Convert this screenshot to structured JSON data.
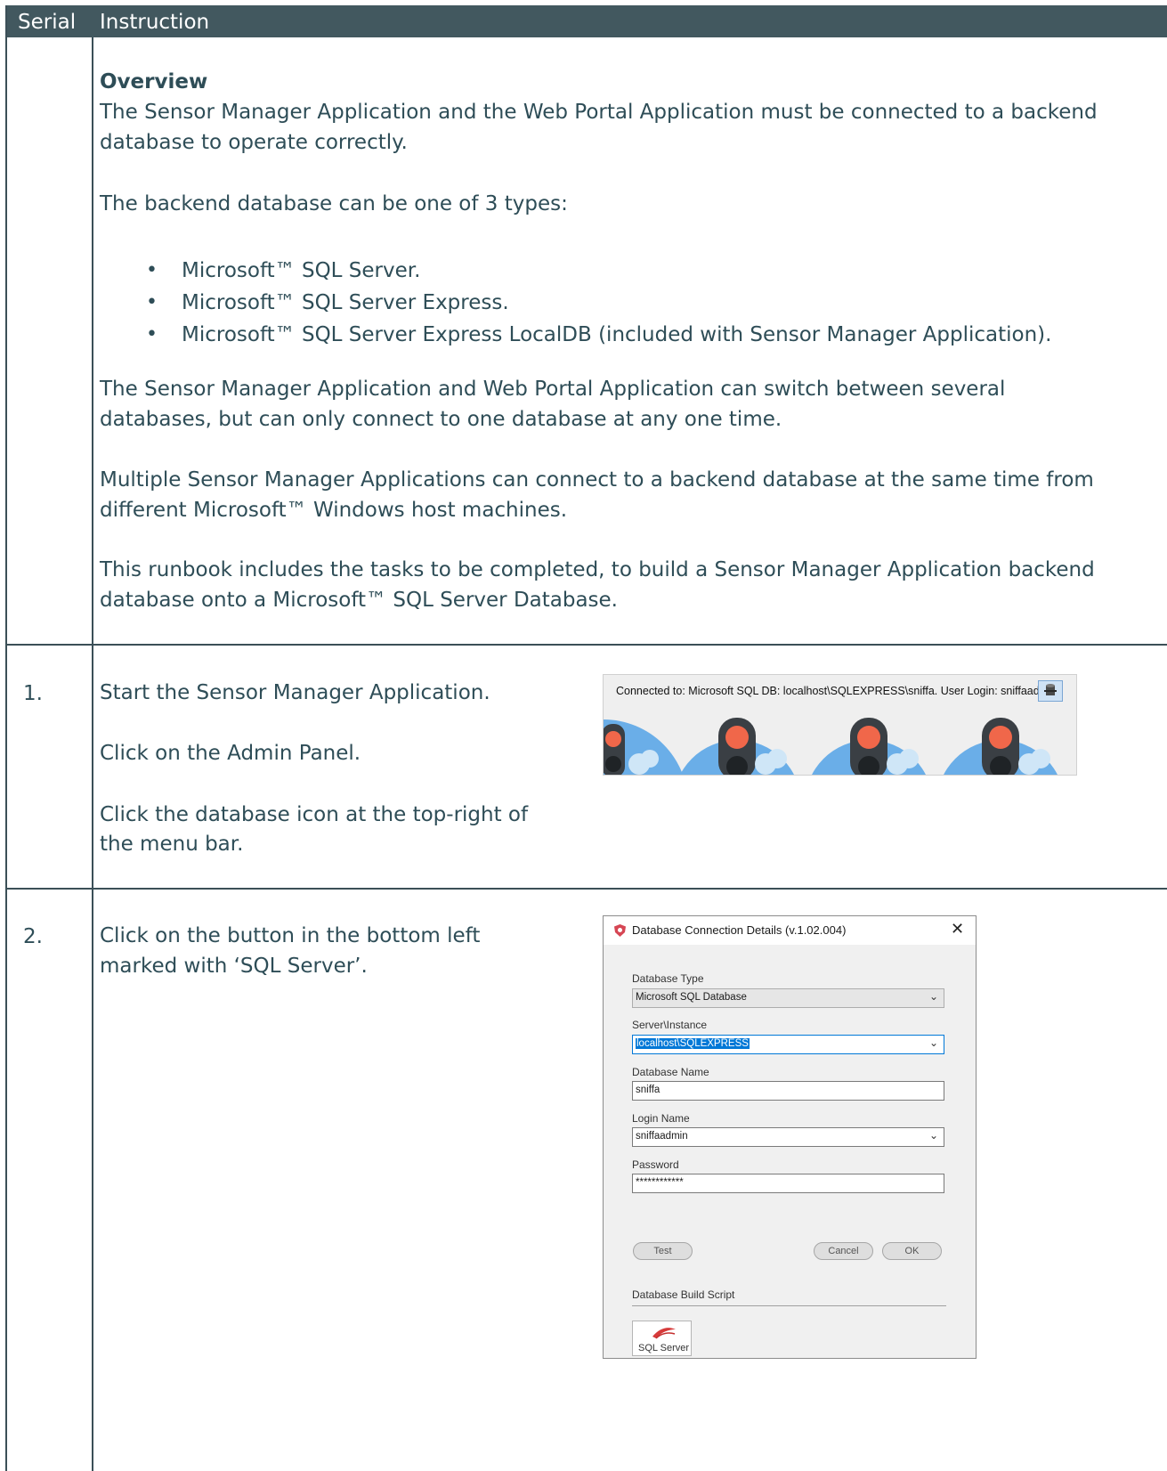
{
  "header": {
    "col1": "Serial",
    "col2": "Instruction"
  },
  "overview": {
    "heading": "Overview",
    "p1a": "The Sensor Manager Application and the Web Portal Application must be connected to a backend",
    "p1b": "database to operate correctly.",
    "p2": "The backend database can be one of 3 types:",
    "bullets": [
      "Microsoft™ SQL Server.",
      "Microsoft™ SQL Server Express.",
      "Microsoft™ SQL Server Express LocalDB (included with Sensor Manager Application)."
    ],
    "p3a": "The Sensor Manager Application and Web Portal Application can switch between several",
    "p3b": "databases, but can only connect to one database at any one time.",
    "p4a": "Multiple Sensor Manager Applications can connect to a backend database at the same time from",
    "p4b": "different Microsoft™ Windows host machines.",
    "p5a": "This runbook includes the tasks to be completed, to build a Sensor Manager Application backend",
    "p5b": "database onto a Microsoft™ SQL Server Database."
  },
  "step1": {
    "serial": "1.",
    "line1": "Start the Sensor Manager Application.",
    "line2": "Click on the Admin Panel.",
    "line3a": "Click the database icon at the top-right of",
    "line3b": "the menu bar.",
    "status_text": "Connected to: Microsoft SQL DB: localhost\\SQLEXPRESS\\sniffa. User Login: sniffaadmin.",
    "db_icon": "database-icon"
  },
  "step2": {
    "serial": "2.",
    "line1": "Click on the button in the bottom left",
    "line2": "marked with ‘SQL Server’."
  },
  "dialog": {
    "title": "Database Connection Details (v.1.02.004)",
    "close": "✕",
    "db_type_label": "Database Type",
    "db_type_value": "Microsoft SQL Database",
    "server_label": "Server\\Instance",
    "server_value": "localhost\\SQLEXPRESS",
    "dbname_label": "Database Name",
    "dbname_value": "sniffa",
    "login_label": "Login Name",
    "login_value": "sniffaadmin",
    "password_label": "Password",
    "password_value": "************",
    "test": "Test",
    "cancel": "Cancel",
    "ok": "OK",
    "build_script_label": "Database Build Script",
    "sql_server_button": "SQL Server"
  },
  "colors": {
    "header_bg": "#42585f",
    "text": "#2e4d57",
    "accent_blue": "#0078d7",
    "light_blue": "#6aaee8",
    "signal_red": "#f0674a"
  }
}
